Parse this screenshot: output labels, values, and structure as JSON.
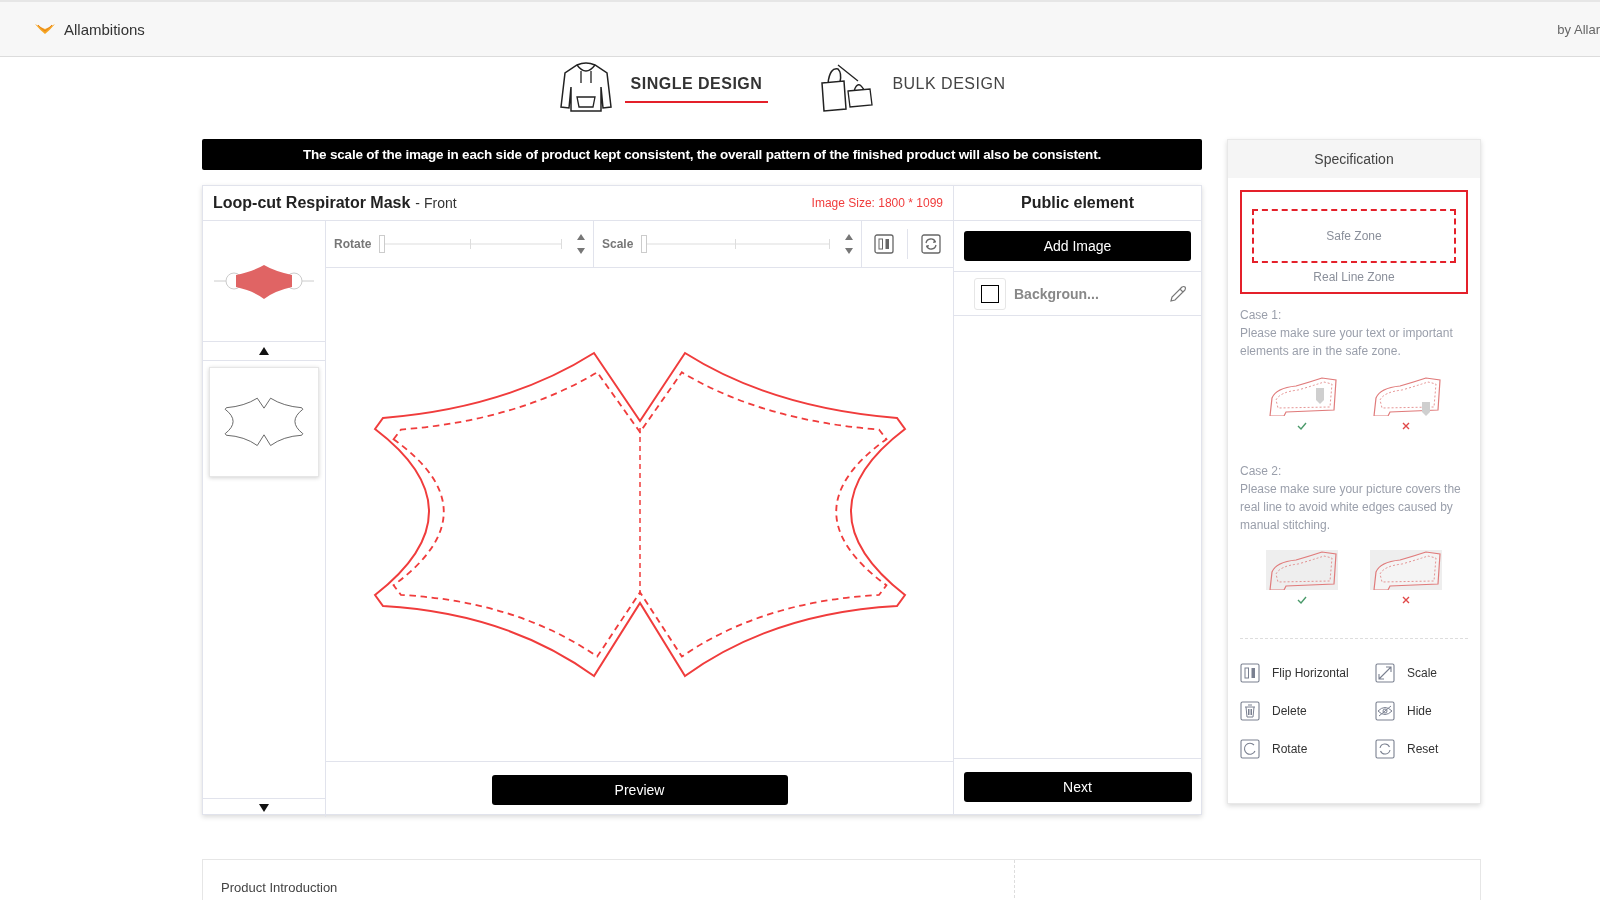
{
  "header": {
    "brand": "Allambitions",
    "byline": "by Allar"
  },
  "design_tabs": [
    {
      "label": "SINGLE DESIGN",
      "kind": "hoodie",
      "selected": true
    },
    {
      "label": "BULK DESIGN",
      "kind": "bags",
      "selected": false
    }
  ],
  "notice": "The scale of the image in each side of product kept consistent, the overall pattern of the finished product will also be consistent.",
  "editor": {
    "product": "Loop-cut Respirator Mask",
    "side": "- Front",
    "image_size": "Image Size: 1800 * 1099",
    "thumbnails": [
      {
        "kind": "photo",
        "selected": false
      },
      {
        "kind": "pattern",
        "selected": true
      }
    ],
    "controls": [
      {
        "label": "Rotate",
        "level": 0
      },
      {
        "label": "Scale",
        "level": 0
      }
    ],
    "preview_button": "Preview"
  },
  "public_panel": {
    "title": "Public element",
    "add_button": "Add Image",
    "layers": [
      {
        "name": "Backgroun..."
      }
    ],
    "next_button": "Next"
  },
  "specification": {
    "title": "Specification",
    "safe_zone": "Safe Zone",
    "real_line_zone": "Real Line Zone",
    "cases": [
      {
        "title": "Case 1:",
        "text": "Please make sure your text or important elements are in the safe zone.",
        "kind": "inside"
      },
      {
        "title": "Case 2:",
        "text": "Please make sure your picture covers the real line to avoid white edges caused by manual stitching.",
        "kind": "cover"
      }
    ],
    "tools": [
      {
        "kind": "flip",
        "label": "Flip Horizontal"
      },
      {
        "kind": "scale",
        "label": "Scale"
      },
      {
        "kind": "delete",
        "label": "Delete"
      },
      {
        "kind": "hide",
        "label": "Hide"
      },
      {
        "kind": "rotate",
        "label": "Rotate"
      },
      {
        "kind": "reset",
        "label": "Reset"
      }
    ]
  },
  "product_intro": {
    "title": "Product Introduction"
  }
}
